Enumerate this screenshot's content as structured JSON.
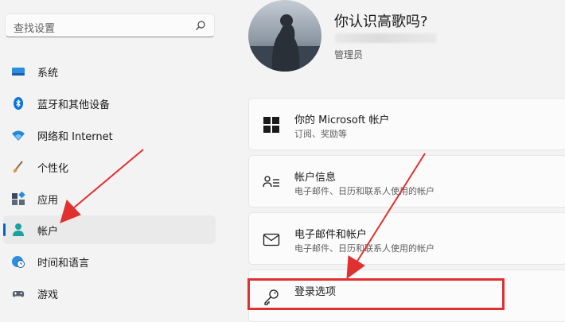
{
  "search": {
    "placeholder": "查找设置"
  },
  "sidebar": {
    "items": [
      {
        "label": "系统",
        "icon": "monitor-icon"
      },
      {
        "label": "蓝牙和其他设备",
        "icon": "bluetooth-icon"
      },
      {
        "label": "网络和 Internet",
        "icon": "wifi-icon"
      },
      {
        "label": "个性化",
        "icon": "brush-icon"
      },
      {
        "label": "应用",
        "icon": "apps-icon"
      },
      {
        "label": "帐户",
        "icon": "account-icon",
        "selected": true
      },
      {
        "label": "时间和语言",
        "icon": "globe-clock-icon"
      },
      {
        "label": "游戏",
        "icon": "gamepad-icon"
      }
    ]
  },
  "profile": {
    "name": "你认识高歌吗?",
    "role": "管理员"
  },
  "cards": [
    {
      "title": "你的 Microsoft 帐户",
      "desc": "订阅、奖励等",
      "icon": "windows-logo-icon"
    },
    {
      "title": "帐户信息",
      "desc": "电子邮件、日历和联系人使用的帐户",
      "icon": "account-info-icon"
    },
    {
      "title": "电子邮件和帐户",
      "desc": "电子邮件、日历和联系人使用的帐户",
      "icon": "mail-icon"
    },
    {
      "title": "登录选项",
      "desc": "",
      "icon": "key-icon"
    }
  ],
  "colors": {
    "accent": "#0067c0",
    "annotation_red": "#e03131"
  }
}
